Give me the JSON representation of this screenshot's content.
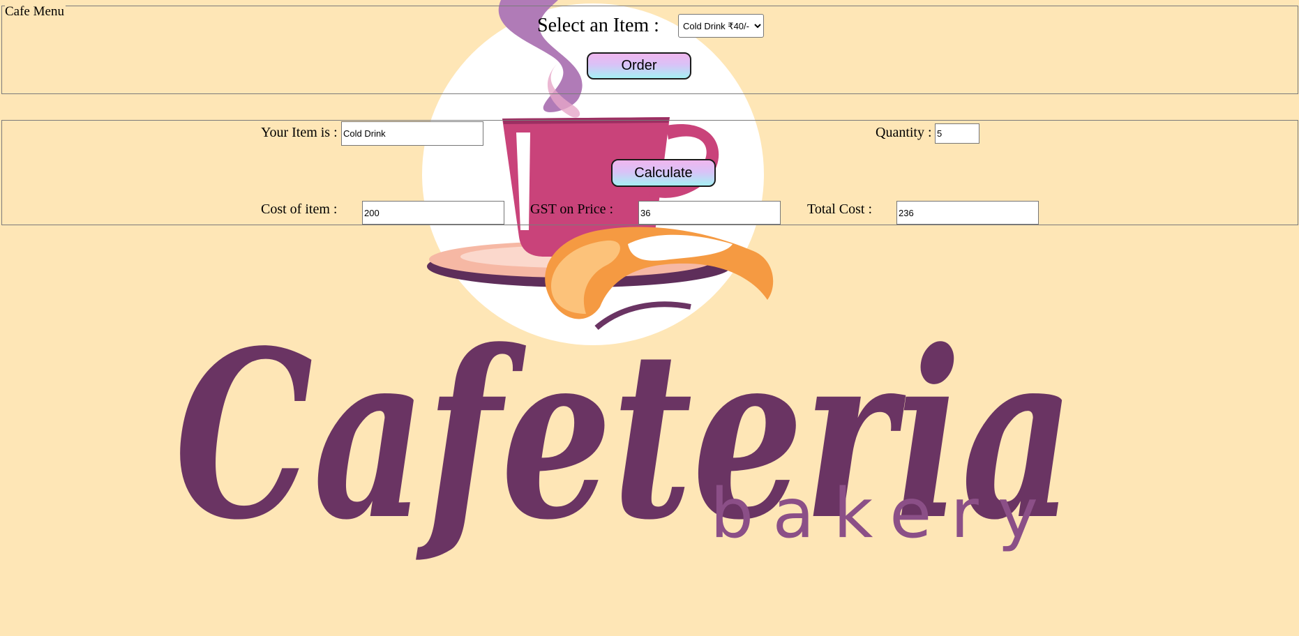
{
  "brand": {
    "logo_word": "Cafeteria",
    "logo_sub": "bakery",
    "colors": {
      "background": "#fee6b6",
      "logo_purple": "#6a3463",
      "sub_purple": "#8b4f87",
      "cup_pink": "#c9437a",
      "croissant_orange": "#f59a42",
      "button_gradient_top": "#f0b6ee",
      "button_gradient_bottom": "#a6f0f4"
    }
  },
  "menu_section": {
    "legend": "Cafe Menu",
    "select_label": "Select an Item :",
    "select_value": "Cold Drink ₹40/-",
    "order_button": "Order"
  },
  "order_section": {
    "item_label": "Your Item is :",
    "item_value": "Cold Drink",
    "quantity_label": "Quantity :",
    "quantity_value": "5",
    "calculate_button": "Calculate",
    "cost_label": "Cost of item :",
    "cost_value": "200",
    "gst_label": "GST on Price :",
    "gst_value": "36",
    "total_label": "Total Cost :",
    "total_value": "236"
  }
}
